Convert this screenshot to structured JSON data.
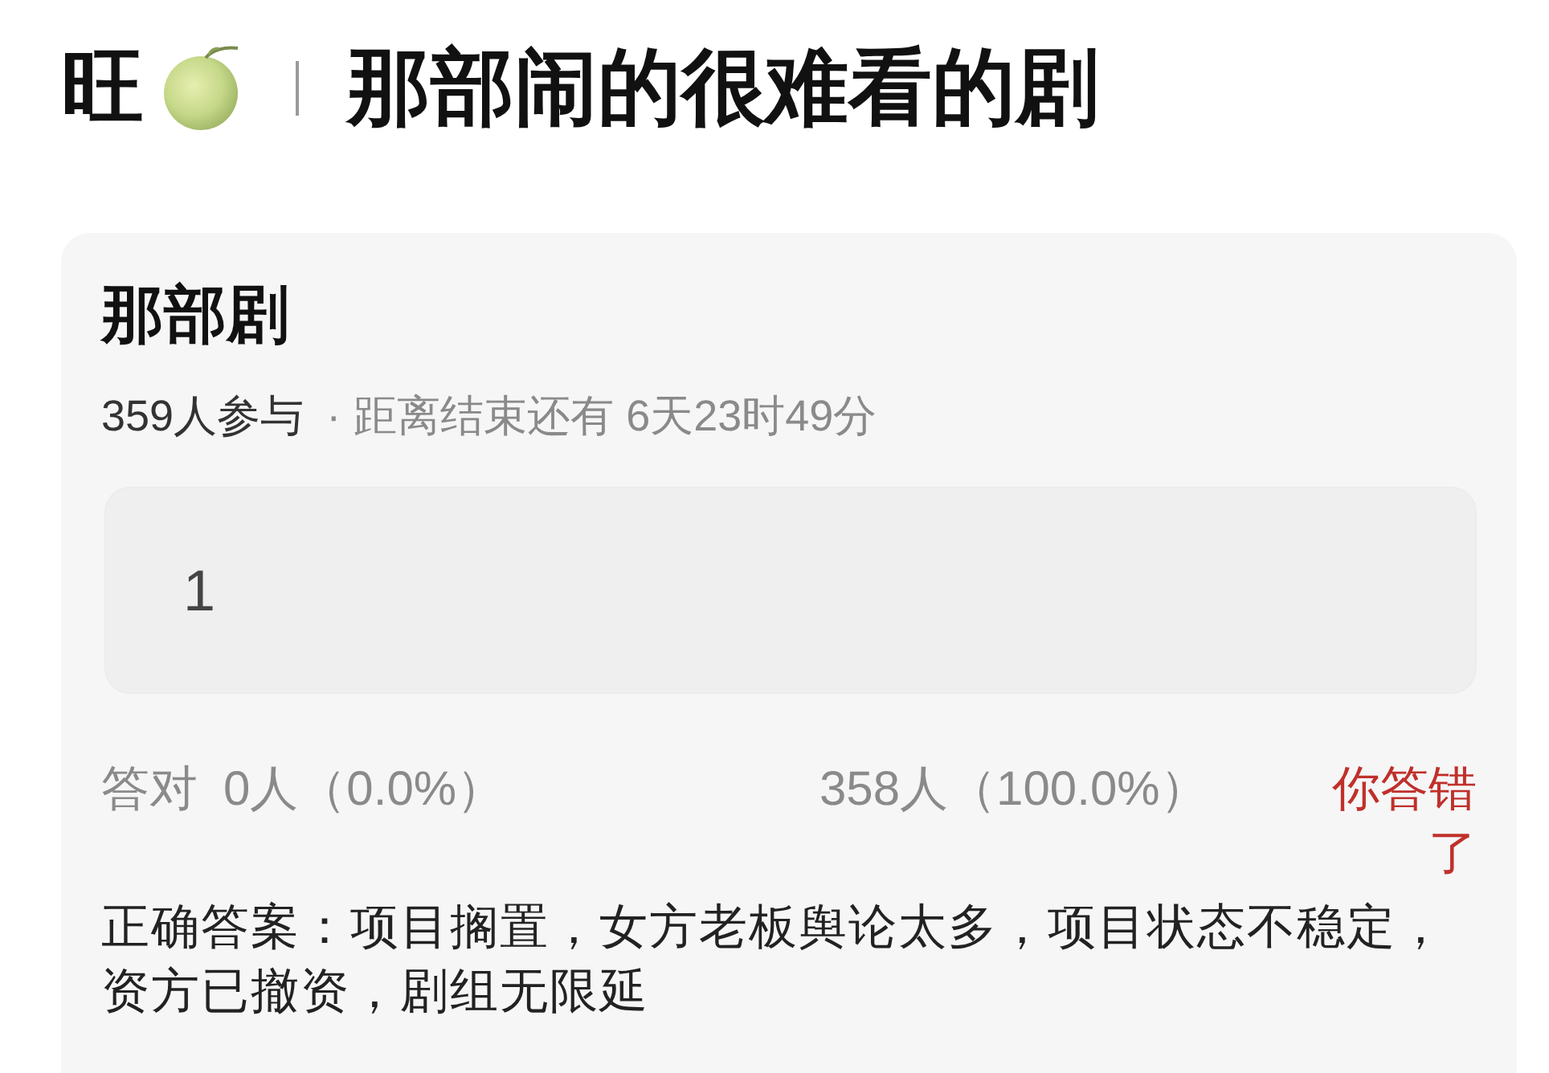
{
  "header": {
    "author": "旺",
    "title": "那部闹的很难看的剧"
  },
  "quiz": {
    "title": "那部剧",
    "participants": "359人参与",
    "separator": "·",
    "countdown": "距离结束还有 6天23时49分",
    "answer": "1",
    "stats": {
      "correct_label": "答对",
      "correct_count": "0人（0.0%）",
      "other_count": "358人（100.0%）"
    },
    "result": {
      "text": "你答错了",
      "correct": false
    },
    "correct_answer": "正确答案：项目搁置，女方老板舆论太多，项目状态不稳定，资方已撤资，剧组无限延"
  }
}
